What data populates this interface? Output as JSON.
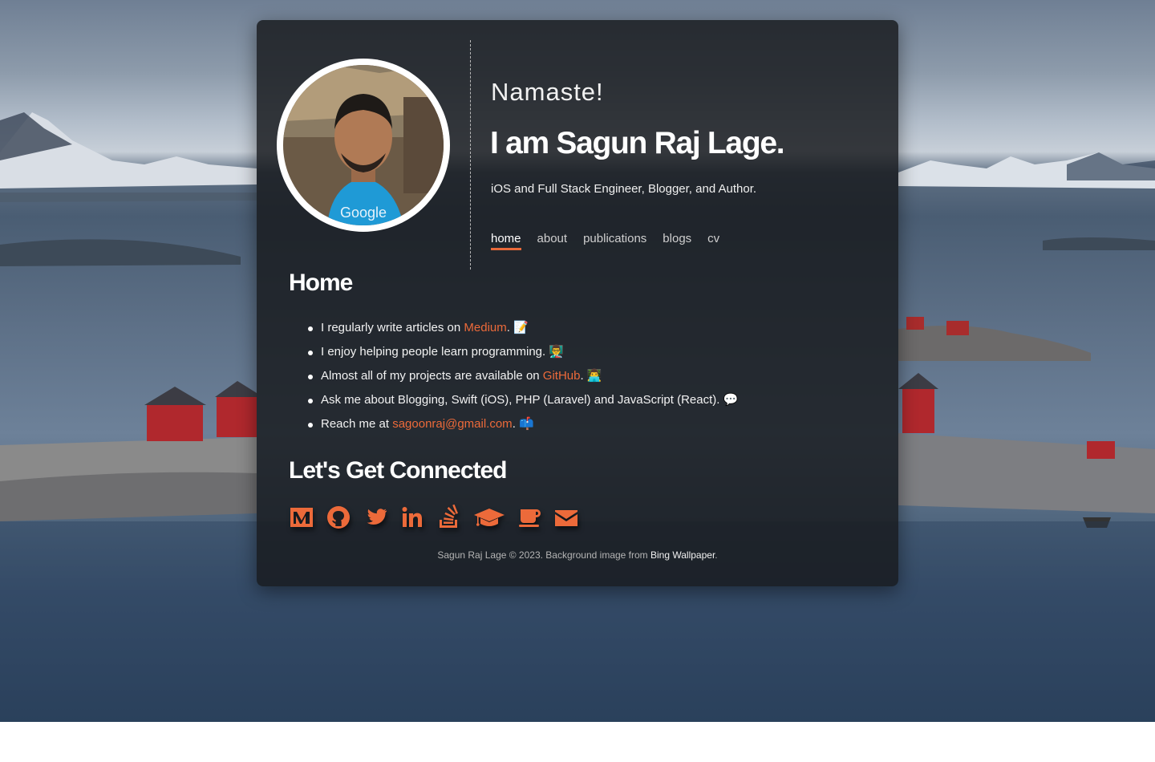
{
  "header": {
    "greeting": "Namaste!",
    "name": "I am Sagun Raj Lage.",
    "tagline": "iOS and Full Stack Engineer, Blogger, and Author."
  },
  "nav": {
    "items": [
      "home",
      "about",
      "publications",
      "blogs",
      "cv"
    ],
    "active": "home"
  },
  "home": {
    "title": "Home",
    "bullets": [
      {
        "before": "I regularly write articles on ",
        "link": "Medium",
        "after": ". 📝"
      },
      {
        "before": "I enjoy helping people learn programming. 👨‍🏫",
        "link": "",
        "after": ""
      },
      {
        "before": "Almost all of my projects are available on ",
        "link": "GitHub",
        "after": ". 👨‍💻"
      },
      {
        "before": "Ask me about Blogging, Swift (iOS), PHP (Laravel) and JavaScript (React). 💬",
        "link": "",
        "after": ""
      },
      {
        "before": "Reach me at ",
        "link": "sagoonraj@gmail.com",
        "after": ". 📫"
      }
    ]
  },
  "connect": {
    "title": "Let's Get Connected",
    "icons": [
      "medium-icon",
      "github-icon",
      "twitter-icon",
      "linkedin-icon",
      "stackoverflow-icon",
      "graduation-cap-icon",
      "coffee-icon",
      "envelope-icon"
    ]
  },
  "footer": {
    "text": "Sagun Raj Lage © 2023. Background image from ",
    "link": "Bing Wallpaper",
    "end": "."
  },
  "colors": {
    "accent": "#e8693a",
    "card": "#181a1e"
  }
}
